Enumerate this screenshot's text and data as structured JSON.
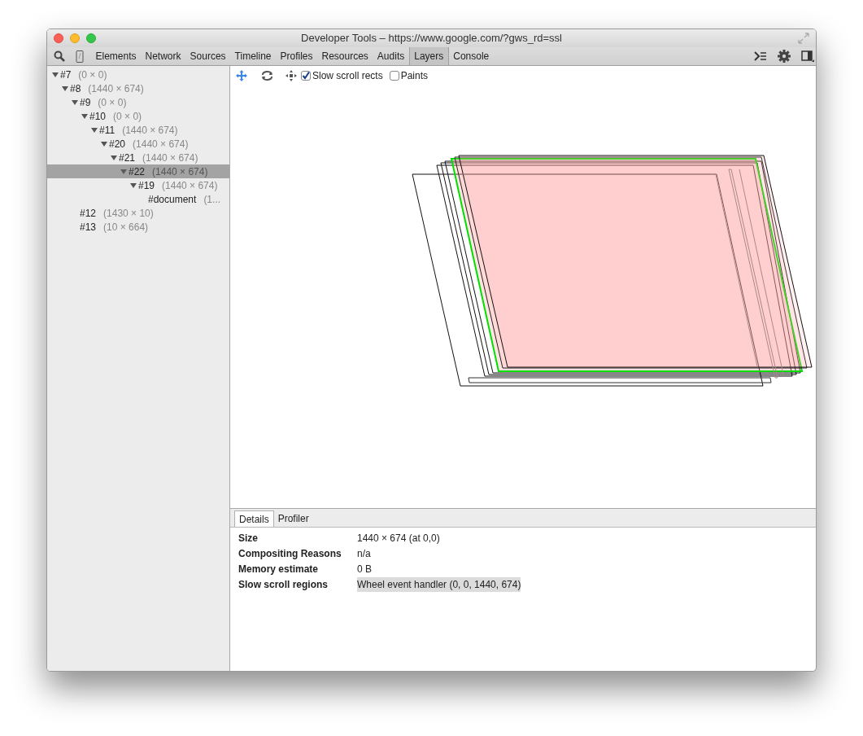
{
  "window": {
    "title": "Developer Tools – https://www.google.com/?gws_rd=ssl"
  },
  "tabs": [
    {
      "label": "Elements",
      "selected": false
    },
    {
      "label": "Network",
      "selected": false
    },
    {
      "label": "Sources",
      "selected": false
    },
    {
      "label": "Timeline",
      "selected": false
    },
    {
      "label": "Profiles",
      "selected": false
    },
    {
      "label": "Resources",
      "selected": false
    },
    {
      "label": "Audits",
      "selected": false
    },
    {
      "label": "Layers",
      "selected": true
    },
    {
      "label": "Console",
      "selected": false
    }
  ],
  "layer_tree": [
    {
      "name": "#7",
      "size": "(0 × 0)",
      "expanded": true,
      "selected": false,
      "children": [
        {
          "name": "#8",
          "size": "(1440 × 674)",
          "expanded": true,
          "selected": false,
          "children": [
            {
              "name": "#9",
              "size": "(0 × 0)",
              "expanded": true,
              "selected": false,
              "children": [
                {
                  "name": "#10",
                  "size": "(0 × 0)",
                  "expanded": true,
                  "selected": false,
                  "children": [
                    {
                      "name": "#11",
                      "size": "(1440 × 674)",
                      "expanded": true,
                      "selected": false,
                      "children": [
                        {
                          "name": "#20",
                          "size": "(1440 × 674)",
                          "expanded": true,
                          "selected": false,
                          "children": [
                            {
                              "name": "#21",
                              "size": "(1440 × 674)",
                              "expanded": true,
                              "selected": false,
                              "children": [
                                {
                                  "name": "#22",
                                  "size": "(1440 × 674)",
                                  "expanded": true,
                                  "selected": true,
                                  "children": [
                                    {
                                      "name": "#19",
                                      "size": "(1440 × 674)",
                                      "expanded": true,
                                      "selected": false,
                                      "children": [
                                        {
                                          "name": "#document",
                                          "size": "(1...",
                                          "selected": false
                                        }
                                      ]
                                    }
                                  ]
                                }
                              ]
                            }
                          ]
                        }
                      ]
                    }
                  ]
                }
              ]
            },
            {
              "name": "#12",
              "size": "(1430 × 10)",
              "selected": false
            },
            {
              "name": "#13",
              "size": "(10 × 664)",
              "selected": false
            }
          ]
        }
      ]
    }
  ],
  "toolbar": {
    "checkboxes": [
      {
        "label": "Slow scroll rects",
        "checked": true
      },
      {
        "label": "Paints",
        "checked": false
      }
    ]
  },
  "details": {
    "tabs": [
      {
        "label": "Details",
        "selected": true
      },
      {
        "label": "Profiler",
        "selected": false
      }
    ],
    "rows": [
      {
        "label": "Size",
        "value": "1440 × 674 (at 0,0)",
        "highlighted": false
      },
      {
        "label": "Compositing Reasons",
        "value": "n/a",
        "highlighted": false
      },
      {
        "label": "Memory estimate",
        "value": "0 B",
        "highlighted": false
      },
      {
        "label": "Slow scroll regions",
        "value": "Wheel event handler (0, 0, 1440, 674)",
        "highlighted": true
      }
    ]
  }
}
